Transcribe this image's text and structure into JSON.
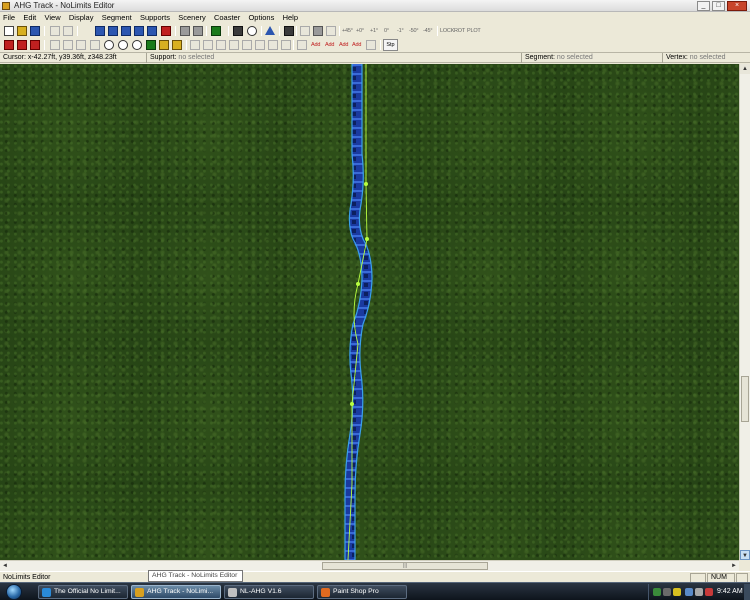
{
  "window": {
    "title": "AHG Track - NoLimits Editor"
  },
  "menu": [
    "File",
    "Edit",
    "View",
    "Display",
    "Segment",
    "Supports",
    "Scenery",
    "Coaster",
    "Options",
    "Help"
  ],
  "toolbar": {
    "row1_text_buttons": [
      "+45°",
      "+0°",
      "+1°",
      "0°",
      "-1°",
      "-50°",
      "-45°"
    ],
    "row1_lock_labels": [
      "LOCK",
      "ROLL",
      "ROT",
      "ROLL",
      "PLOT",
      "ROLL",
      "PLOT"
    ],
    "row2_text_labels": [
      "Add",
      "Add",
      "Add",
      "Add"
    ],
    "stop_label": "Stp"
  },
  "info_bar": {
    "cursor_label": "Cursor:",
    "cursor_value": "x-42.27ft, y39.36ft, z348.23ft",
    "support_label": "Support:",
    "support_value": "no selected",
    "segment_label": "Segment:",
    "segment_value": "no selected",
    "vertex_label": "Vertex:",
    "vertex_value": "no selected"
  },
  "colors": {
    "grass": "#2a4a18",
    "track_rail": "#3aa0e8",
    "track_tie": "#1a3aa0",
    "spline": "#b8ff40",
    "selection": "#c8dff4"
  },
  "scrollbars": {
    "vertical_up_icon": "up-arrow-icon",
    "vertical_down_icon": "down-arrow-icon",
    "h_left_icon": "left-arrow-icon",
    "h_right_icon": "right-arrow-icon"
  },
  "status_bar": {
    "text": "NoLimits Editor",
    "num": "NUM"
  },
  "tooltip": "AHG Track - NoLimits Editor",
  "taskbar": {
    "buttons": [
      {
        "label": "The Official No Limit...",
        "icon_color": "#2a8ad8"
      },
      {
        "label": "AHG Track - NoLimi...",
        "icon_color": "#d8a020"
      },
      {
        "label": "NL-AHG V1.6",
        "icon_color": "#c0c0c0"
      },
      {
        "label": "Paint Shop Pro",
        "icon_color": "#e06a20"
      }
    ],
    "clock": "9:42 AM"
  }
}
